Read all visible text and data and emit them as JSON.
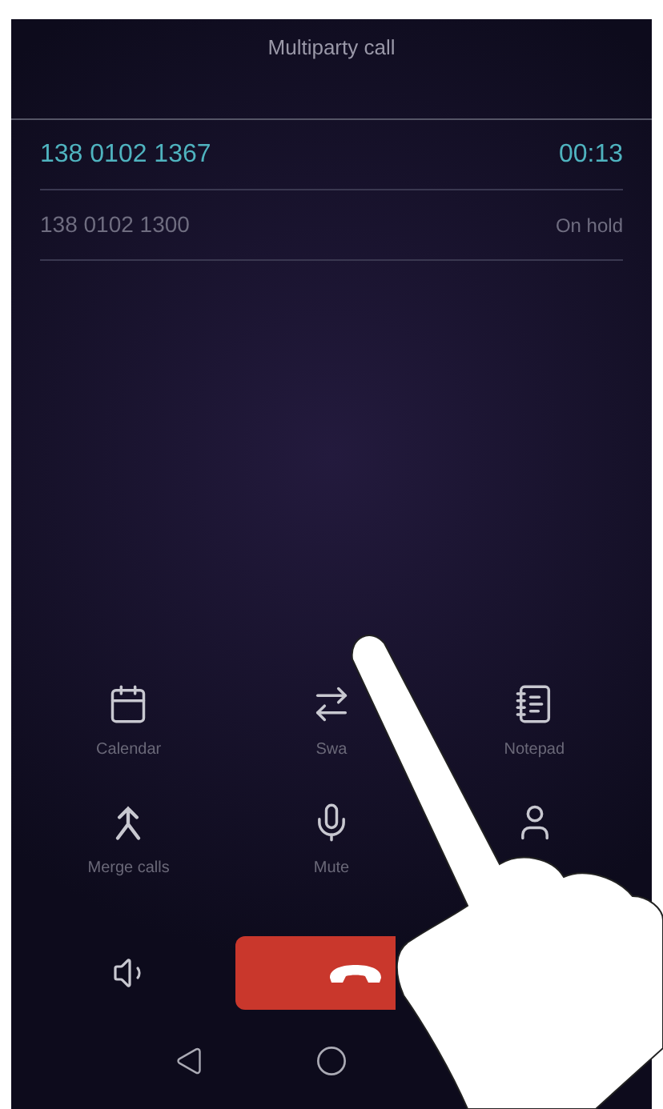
{
  "title": "Multiparty call",
  "calls": [
    {
      "number": "138 0102 1367",
      "status": "00:13",
      "active": true
    },
    {
      "number": "138 0102 1300",
      "status": "On hold",
      "active": false
    }
  ],
  "actions": [
    {
      "kind": "calendar",
      "label": "Calendar"
    },
    {
      "kind": "swap",
      "label": "Swa"
    },
    {
      "kind": "notepad",
      "label": "Notepad"
    },
    {
      "kind": "merge",
      "label": "Merge calls"
    },
    {
      "kind": "mute",
      "label": "Mute"
    },
    {
      "kind": "contacts"
    }
  ]
}
